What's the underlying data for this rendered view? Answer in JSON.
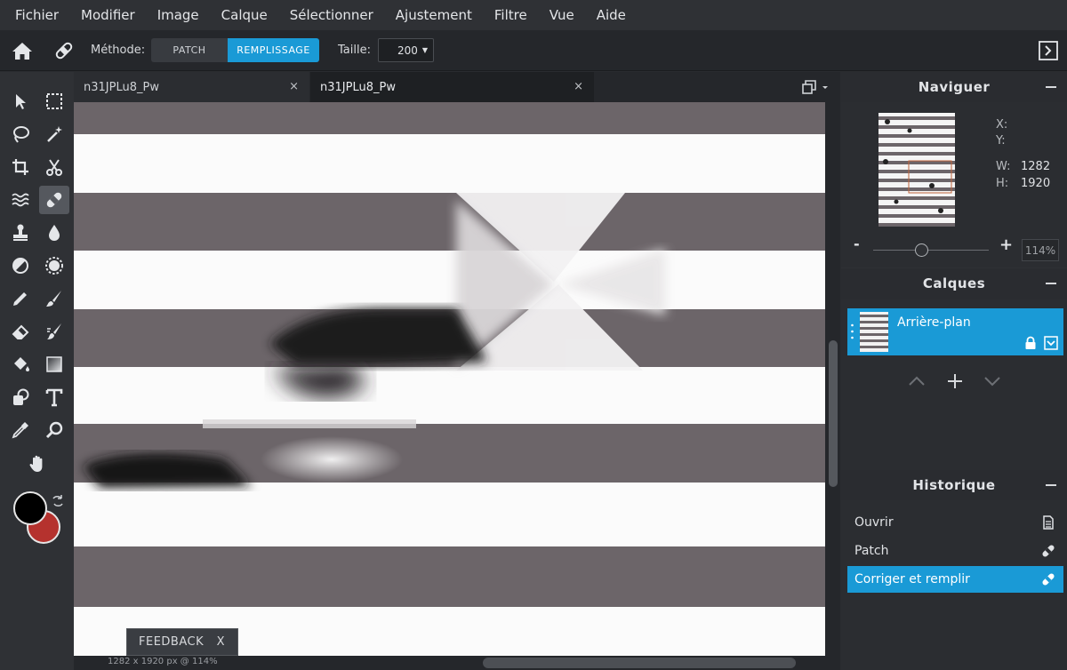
{
  "menu": [
    "Fichier",
    "Modifier",
    "Image",
    "Calque",
    "Sélectionner",
    "Ajustement",
    "Filtre",
    "Vue",
    "Aide"
  ],
  "options": {
    "method_label": "Méthode:",
    "patch": "PATCH",
    "fill": "REMPLISSAGE",
    "size_label": "Taille:",
    "size_value": "200"
  },
  "tabs": [
    {
      "title": "n31JPLu8_Pw"
    },
    {
      "title": "n31JPLu8_Pw"
    }
  ],
  "tab_close": "×",
  "feedback": {
    "label": "FEEDBACK",
    "close": "X"
  },
  "status": "1282 x 1920 px @ 114%",
  "navigator": {
    "title": "Naviguer",
    "x_label": "X:",
    "y_label": "Y:",
    "w_label": "W:",
    "w_value": "1282",
    "h_label": "H:",
    "h_value": "1920",
    "zoom": "114%",
    "minus": "-",
    "plus": "+"
  },
  "layers": {
    "title": "Calques",
    "items": [
      {
        "name": "Arrière-plan"
      }
    ]
  },
  "history": {
    "title": "Historique",
    "items": [
      {
        "label": "Ouvrir"
      },
      {
        "label": "Patch"
      },
      {
        "label": "Corriger et remplir"
      }
    ]
  },
  "colors": {
    "accent": "#1a9ad6",
    "foreground": "#000000",
    "background": "#b5322e"
  }
}
